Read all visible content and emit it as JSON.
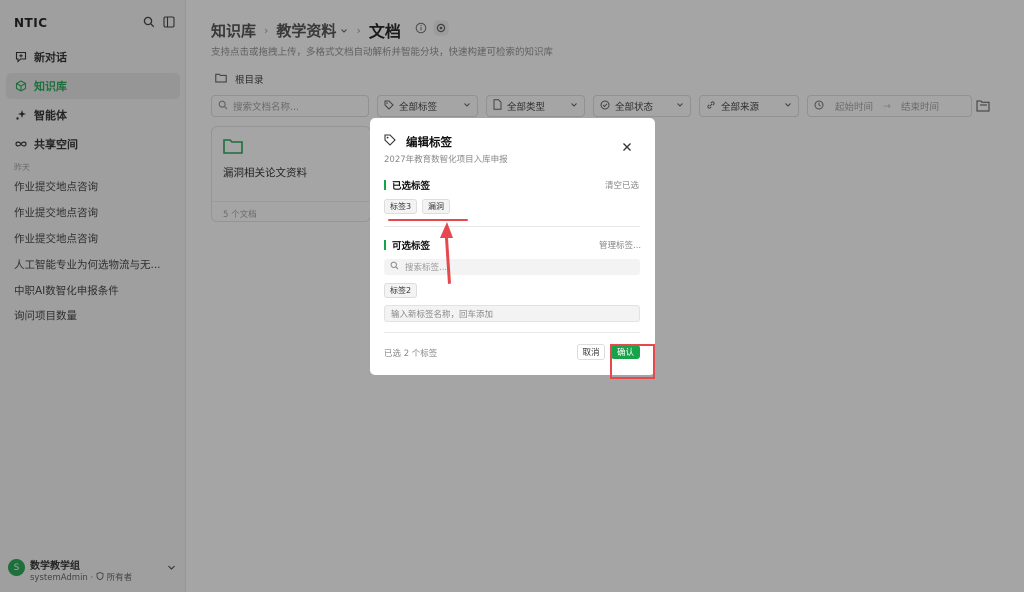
{
  "sidebar": {
    "logo": "NTIC",
    "nav": [
      {
        "label": "新对话",
        "icon": "chat-plus-icon"
      },
      {
        "label": "知识库",
        "icon": "cube-icon",
        "active": true
      },
      {
        "label": "智能体",
        "icon": "sparkle-icon"
      },
      {
        "label": "共享空间",
        "icon": "infinity-icon"
      }
    ],
    "history_label": "昨天",
    "history": [
      "作业提交地点咨询",
      "作业提交地点咨询",
      "作业提交地点咨询",
      "人工智能专业为何选物流与无...",
      "中职AI数智化申报条件",
      "询问项目数量"
    ],
    "user": {
      "avatar_letter": "S",
      "name": "数学教学组",
      "account": "systemAdmin",
      "role": "所有者"
    }
  },
  "main": {
    "breadcrumb": [
      "知识库",
      "教学资料",
      "文档"
    ],
    "subtitle": "支持点击或拖拽上传，多格式文档自动解析并智能分块，快速构建可检索的知识库",
    "root": "根目录",
    "filters": {
      "search_placeholder": "搜索文档名称...",
      "tags": "全部标签",
      "types": "全部类型",
      "status": "全部状态",
      "source": "全部来源",
      "start_placeholder": "起始时间",
      "end_placeholder": "结束时间"
    },
    "card": {
      "title": "漏洞相关论文资料",
      "count": "5 个文档"
    }
  },
  "modal": {
    "title": "编辑标签",
    "subtitle": "2027年教育数智化项目入库申报",
    "selected_title": "已选标签",
    "clear": "清空已选",
    "selected_tags": [
      "标签3",
      "漏洞"
    ],
    "available_title": "可选标签",
    "manage": "管理标签...",
    "search_placeholder": "搜索标签...",
    "available_tags": [
      "标签2"
    ],
    "new_placeholder": "输入新标签名称，回车添加",
    "count": "已选 2 个标签",
    "cancel": "取消",
    "confirm": "确认"
  },
  "colors": {
    "accent": "#16a34a",
    "annotation": "#e5484d"
  }
}
